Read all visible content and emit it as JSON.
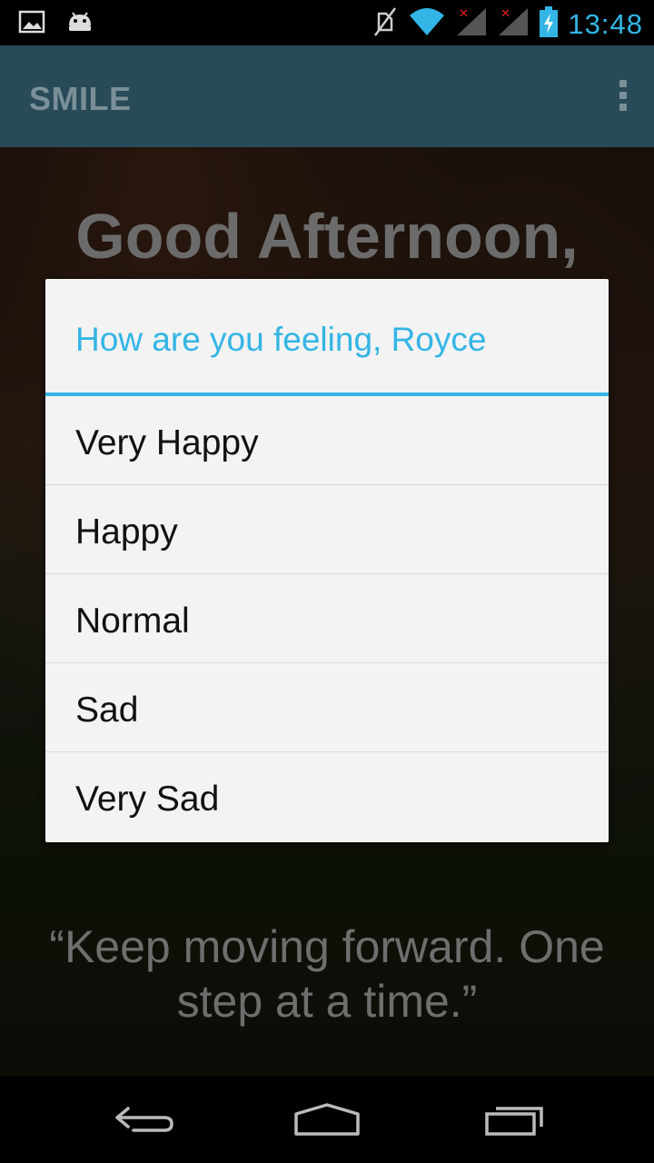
{
  "status_bar": {
    "time": "13:48",
    "icons": [
      "image-icon",
      "android-icon",
      "mute-icon",
      "wifi-icon",
      "signal-icon",
      "signal-icon",
      "battery-charging-icon"
    ]
  },
  "action_bar": {
    "title": "SMILE",
    "overflow_icon": "overflow-menu-icon"
  },
  "background": {
    "greeting": "Good Afternoon,",
    "quote": "“Keep moving forward. One step at a time.”"
  },
  "dialog": {
    "title": "How are you feeling, Royce",
    "options": [
      "Very Happy",
      "Happy",
      "Normal",
      "Sad",
      "Very Sad"
    ]
  },
  "nav_bar": {
    "icons": [
      "back-icon",
      "home-icon",
      "recents-icon"
    ]
  },
  "colors": {
    "accent": "#33b5e5",
    "action_bar": "#294a58",
    "dialog_bg": "#f3f3f3"
  }
}
